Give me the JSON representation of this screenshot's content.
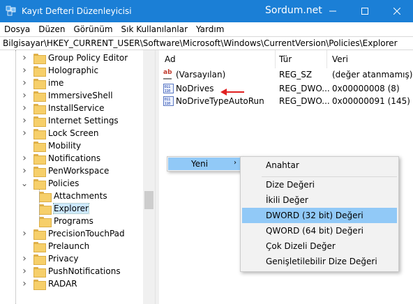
{
  "window": {
    "title": "Kayıt Defteri Düzenleyicisi",
    "watermark": "Sordum.net",
    "accent_color": "#1b7fd6"
  },
  "menu": [
    "Dosya",
    "Düzen",
    "Görünüm",
    "Sık Kullanılanlar",
    "Yardım"
  ],
  "address": "Bilgisayar\\HKEY_CURRENT_USER\\Software\\Microsoft\\Windows\\CurrentVersion\\Policies\\Explorer",
  "tree": {
    "items": [
      {
        "label": "Group Policy Editor",
        "expander": "right"
      },
      {
        "label": "Holographic",
        "expander": "right"
      },
      {
        "label": "ime",
        "expander": "right"
      },
      {
        "label": "ImmersiveShell",
        "expander": "right"
      },
      {
        "label": "InstallService",
        "expander": "right"
      },
      {
        "label": "Internet Settings",
        "expander": "right"
      },
      {
        "label": "Lock Screen",
        "expander": "right"
      },
      {
        "label": "Mobility",
        "expander": "none"
      },
      {
        "label": "Notifications",
        "expander": "right"
      },
      {
        "label": "PenWorkspace",
        "expander": "right"
      },
      {
        "label": "Policies",
        "expander": "down"
      },
      {
        "label": "Attachments",
        "expander": "none",
        "child": true
      },
      {
        "label": "Explorer",
        "expander": "none",
        "child": true,
        "selected": true
      },
      {
        "label": "Programs",
        "expander": "none",
        "child": true
      },
      {
        "label": "PrecisionTouchPad",
        "expander": "right"
      },
      {
        "label": "Prelaunch",
        "expander": "none"
      },
      {
        "label": "Privacy",
        "expander": "right"
      },
      {
        "label": "PushNotifications",
        "expander": "right"
      },
      {
        "label": "RADAR",
        "expander": "right"
      }
    ]
  },
  "list": {
    "columns": [
      "Ad",
      "Tür",
      "Veri"
    ],
    "rows": [
      {
        "name": "(Varsayılan)",
        "type": "REG_SZ",
        "data": "(değer atanmamış)",
        "icon": "string-value-icon"
      },
      {
        "name": "NoDrives",
        "type": "REG_DWO...",
        "data": "0x00000008 (8)",
        "icon": "binary-value-icon"
      },
      {
        "name": "NoDriveTypeAutoRun",
        "type": "REG_DWO...",
        "data": "0x00000091 (145)",
        "icon": "binary-value-icon"
      }
    ]
  },
  "context_menu": {
    "new_label": "Yeni",
    "submenu": [
      {
        "label": "Anahtar"
      },
      {
        "label": "Dize Değeri"
      },
      {
        "label": "İkili Değer"
      },
      {
        "label": "DWORD (32 bit) Değeri",
        "highlighted": true
      },
      {
        "label": "QWORD (64 bit) Değeri"
      },
      {
        "label": "Çok Dizeli Değer"
      },
      {
        "label": "Genişletilebilir Dize Değeri"
      }
    ]
  }
}
